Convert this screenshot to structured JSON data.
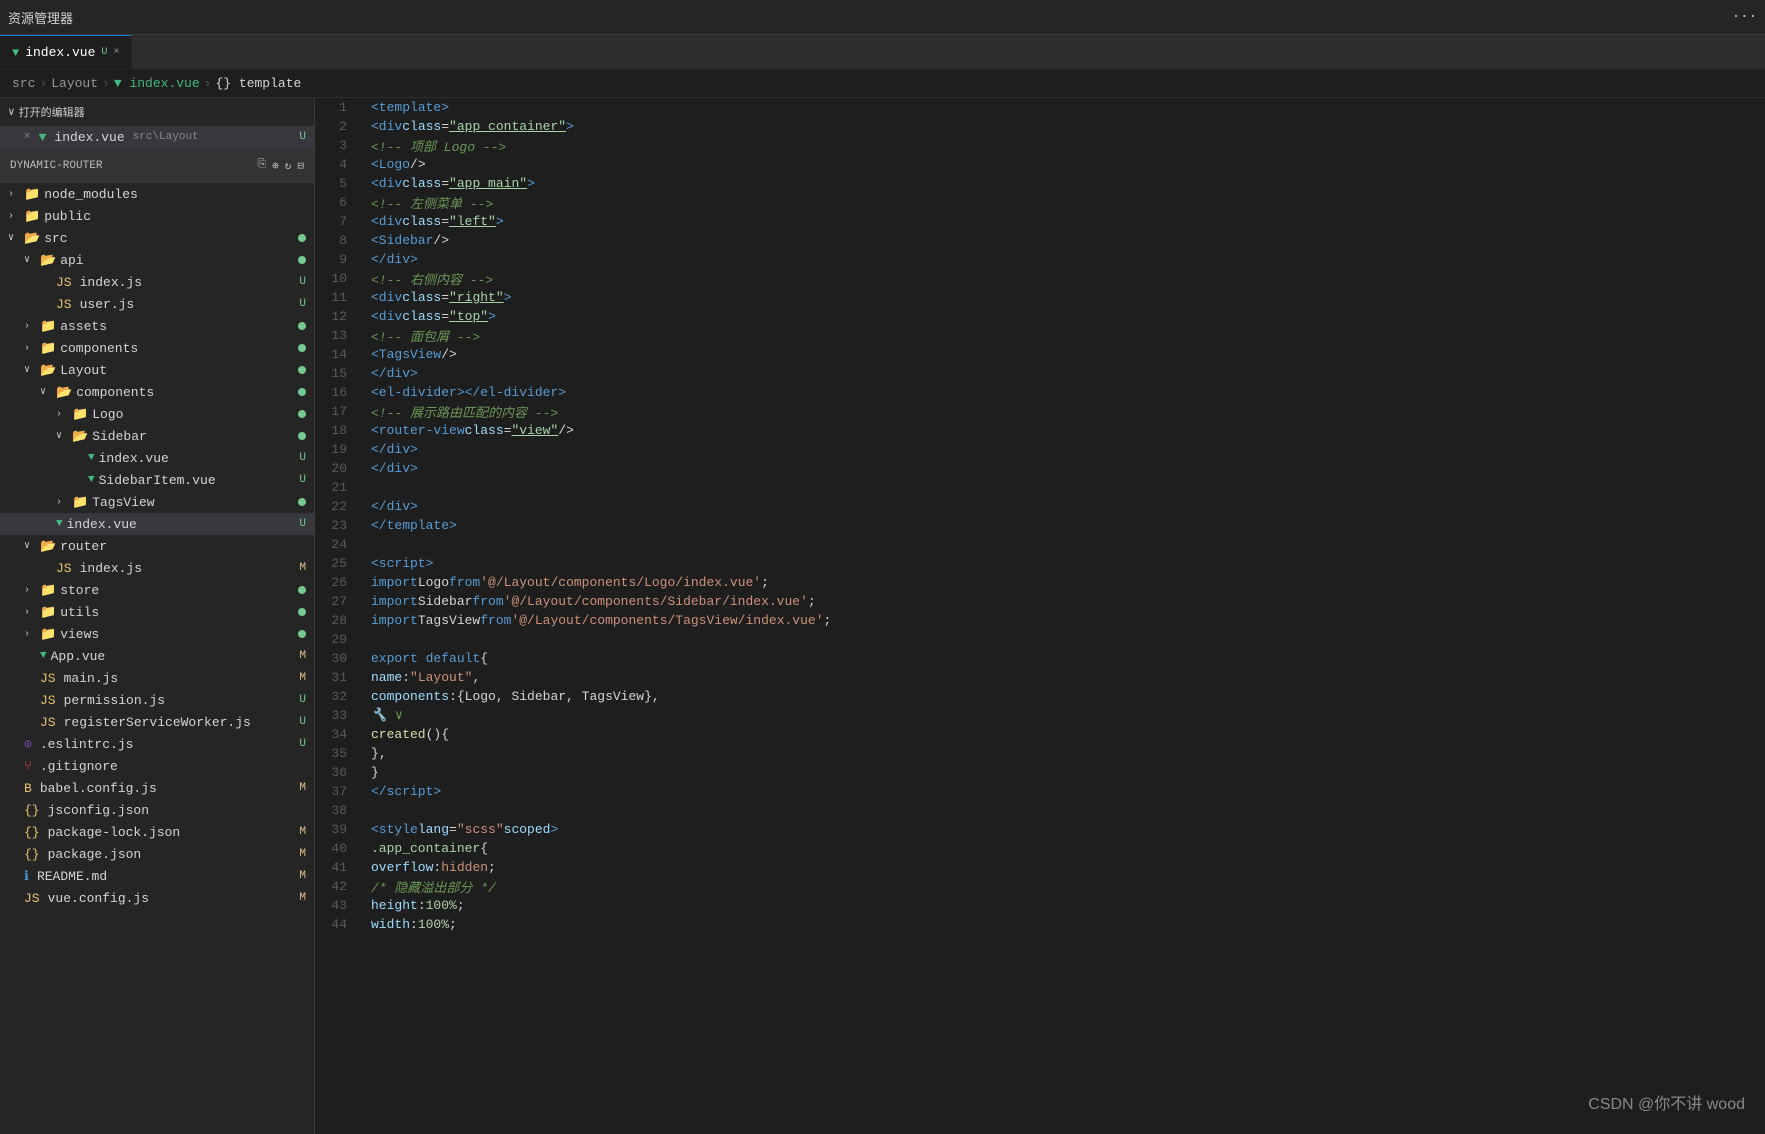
{
  "topbar": {
    "title": "资源管理器",
    "icons": [
      "...",
      "×"
    ]
  },
  "tabs": [
    {
      "id": "index-vue",
      "vue_icon": "▼",
      "label": "index.vue",
      "badge": "U",
      "close": "×",
      "active": true
    }
  ],
  "breadcrumb": {
    "parts": [
      "src",
      ">",
      "Layout",
      ">",
      "▼ index.vue",
      ">",
      "{} template"
    ]
  },
  "sidebar": {
    "open_editors_label": "打开的编辑器",
    "open_editors_arrow": "∨",
    "open_file": {
      "close_icon": "×",
      "vue_icon": "▼",
      "label": "index.vue",
      "path": "src\\Layout",
      "badge": "U"
    },
    "project_name": "DYNAMIC-ROUTER",
    "project_icons": [
      "copy",
      "add-folder",
      "refresh",
      "collapse"
    ],
    "tree": [
      {
        "level": 0,
        "arrow": "›",
        "type": "folder",
        "name": "node_modules",
        "badge": ""
      },
      {
        "level": 0,
        "arrow": "›",
        "type": "folder",
        "name": "public",
        "badge": ""
      },
      {
        "level": 0,
        "arrow": "∨",
        "type": "folder-open",
        "name": "src",
        "dot": "green"
      },
      {
        "level": 1,
        "arrow": "∨",
        "type": "folder-open",
        "name": "api",
        "dot": "green"
      },
      {
        "level": 2,
        "arrow": "",
        "type": "js",
        "name": "index.js",
        "badge": "U"
      },
      {
        "level": 2,
        "arrow": "",
        "type": "js",
        "name": "user.js",
        "badge": "U"
      },
      {
        "level": 1,
        "arrow": "›",
        "type": "folder",
        "name": "assets",
        "dot": "green"
      },
      {
        "level": 1,
        "arrow": "›",
        "type": "folder",
        "name": "components",
        "dot": "green"
      },
      {
        "level": 1,
        "arrow": "∨",
        "type": "folder-open",
        "name": "Layout",
        "dot": "green"
      },
      {
        "level": 2,
        "arrow": "∨",
        "type": "folder-open",
        "name": "components",
        "dot": "green"
      },
      {
        "level": 3,
        "arrow": "›",
        "type": "folder",
        "name": "Logo",
        "dot": "green"
      },
      {
        "level": 3,
        "arrow": "∨",
        "type": "folder-open",
        "name": "Sidebar",
        "dot": "green"
      },
      {
        "level": 4,
        "arrow": "",
        "type": "vue",
        "name": "index.vue",
        "badge": "U"
      },
      {
        "level": 4,
        "arrow": "",
        "type": "vue",
        "name": "SidebarItem.vue",
        "badge": "U"
      },
      {
        "level": 3,
        "arrow": "›",
        "type": "folder",
        "name": "TagsView",
        "dot": "green"
      },
      {
        "level": 2,
        "arrow": "",
        "type": "vue",
        "name": "index.vue",
        "badge": "U",
        "active": true
      },
      {
        "level": 1,
        "arrow": "∨",
        "type": "folder-open",
        "name": "router",
        "badge": ""
      },
      {
        "level": 2,
        "arrow": "",
        "type": "js",
        "name": "index.js",
        "badge": "M"
      },
      {
        "level": 1,
        "arrow": "›",
        "type": "folder",
        "name": "store",
        "dot": "green"
      },
      {
        "level": 1,
        "arrow": "›",
        "type": "folder",
        "name": "utils",
        "dot": "green"
      },
      {
        "level": 1,
        "arrow": "›",
        "type": "folder",
        "name": "views",
        "dot": "green"
      },
      {
        "level": 1,
        "arrow": "",
        "type": "vue",
        "name": "App.vue",
        "badge": "M"
      },
      {
        "level": 1,
        "arrow": "",
        "type": "js",
        "name": "main.js",
        "badge": "M"
      },
      {
        "level": 1,
        "arrow": "",
        "type": "js",
        "name": "permission.js",
        "badge": "U"
      },
      {
        "level": 1,
        "arrow": "",
        "type": "js",
        "name": "registerServiceWorker.js",
        "badge": "U"
      },
      {
        "level": 0,
        "arrow": "",
        "type": "eslint",
        "name": ".eslintrc.js",
        "badge": "U"
      },
      {
        "level": 0,
        "arrow": "",
        "type": "dot",
        "name": ".gitignore",
        "badge": ""
      },
      {
        "level": 0,
        "arrow": "",
        "type": "babel",
        "name": "babel.config.js",
        "badge": "M"
      },
      {
        "level": 0,
        "arrow": "",
        "type": "json",
        "name": "jsconfig.json",
        "badge": ""
      },
      {
        "level": 0,
        "arrow": "",
        "type": "json",
        "name": "package-lock.json",
        "badge": "M"
      },
      {
        "level": 0,
        "arrow": "",
        "type": "json",
        "name": "package.json",
        "badge": "M"
      },
      {
        "level": 0,
        "arrow": "",
        "type": "readme",
        "name": "README.md",
        "badge": "M"
      },
      {
        "level": 0,
        "arrow": "",
        "type": "js",
        "name": "vue.config.js",
        "badge": "M"
      }
    ]
  },
  "code": {
    "lines": [
      {
        "n": 1,
        "html": "<span class='t-tag'>&lt;template&gt;</span>"
      },
      {
        "n": 2,
        "html": "  <span class='t-tag'>&lt;div</span> <span class='t-attr-name'>class</span><span class='t-punct'>=</span><span class='t-attr-val t-class-u'>\"app_container\"</span><span class='t-tag'>&gt;</span>"
      },
      {
        "n": 3,
        "html": "    <span class='t-comment'>&lt;!-- 项部 Logo --&gt;</span>"
      },
      {
        "n": 4,
        "html": "    <span class='t-tag'>&lt;Logo</span> <span class='t-punct'>/&gt;</span>"
      },
      {
        "n": 5,
        "html": "    <span class='t-tag'>&lt;div</span> <span class='t-attr-name'>class</span><span class='t-punct'>=</span><span class='t-attr-val t-class-u'>\"app_main\"</span><span class='t-tag'>&gt;</span>"
      },
      {
        "n": 6,
        "html": "      <span class='t-comment'>&lt;!-- 左侧菜单 --&gt;</span>"
      },
      {
        "n": 7,
        "html": "      <span class='t-tag'>&lt;div</span> <span class='t-attr-name'>class</span><span class='t-punct'>=</span><span class='t-attr-val t-class-u'>\"left\"</span><span class='t-tag'>&gt;</span>"
      },
      {
        "n": 8,
        "html": "        <span class='t-tag'>&lt;Sidebar</span> <span class='t-punct'>/&gt;</span>"
      },
      {
        "n": 9,
        "html": "      <span class='t-tag'>&lt;/div&gt;</span>"
      },
      {
        "n": 10,
        "html": "      <span class='t-comment'>&lt;!-- 右侧内容 --&gt;</span>"
      },
      {
        "n": 11,
        "html": "      <span class='t-tag'>&lt;div</span> <span class='t-attr-name'>class</span><span class='t-punct'>=</span><span class='t-attr-val t-class-u'>\"right\"</span><span class='t-tag'>&gt;</span>"
      },
      {
        "n": 12,
        "html": "        <span class='t-tag'>&lt;div</span> <span class='t-attr-name'>class</span><span class='t-punct'>=</span><span class='t-attr-val t-class-u'>\"top\"</span><span class='t-tag'>&gt;</span>"
      },
      {
        "n": 13,
        "html": "          <span class='t-comment'>&lt;!-- 面包屑 --&gt;</span>"
      },
      {
        "n": 14,
        "html": "          <span class='t-tag'>&lt;TagsView</span> <span class='t-punct'>/&gt;</span>"
      },
      {
        "n": 15,
        "html": "        <span class='t-tag'>&lt;/div&gt;</span>"
      },
      {
        "n": 16,
        "html": "        <span class='t-tag'>&lt;el-divider&gt;&lt;/el-divider&gt;</span>"
      },
      {
        "n": 17,
        "html": "        <span class='t-comment'>&lt;!-- 展示路由匹配的内容 --&gt;</span>"
      },
      {
        "n": 18,
        "html": "        <span class='t-tag'>&lt;router-view</span> <span class='t-attr-name'>class</span><span class='t-punct'>=</span><span class='t-attr-val t-class-u'>\"view\"</span> <span class='t-punct'>/&gt;</span>"
      },
      {
        "n": 19,
        "html": "      <span class='t-tag'>&lt;/div&gt;</span>"
      },
      {
        "n": 20,
        "html": "    <span class='t-tag'>&lt;/div&gt;</span>"
      },
      {
        "n": 21,
        "html": ""
      },
      {
        "n": 22,
        "html": "  <span class='t-tag'>&lt;/div&gt;</span>"
      },
      {
        "n": 23,
        "html": "<span class='t-tag'>&lt;/template&gt;</span>"
      },
      {
        "n": 24,
        "html": ""
      },
      {
        "n": 25,
        "html": "<span class='t-tag'>&lt;script&gt;</span>"
      },
      {
        "n": 26,
        "html": "<span class='t-keyword'>import</span> <span class='t-white'>Logo</span> <span class='t-keyword'>from</span> <span class='t-import-path'>'@/Layout/components/Logo/index.vue'</span><span class='t-punct'>;</span>"
      },
      {
        "n": 27,
        "html": "<span class='t-keyword'>import</span> <span class='t-white'>Sidebar</span> <span class='t-keyword'>from</span> <span class='t-import-path'>'@/Layout/components/Sidebar/index.vue'</span><span class='t-punct'>;</span>"
      },
      {
        "n": 28,
        "html": "<span class='t-keyword'>import</span> <span class='t-white'>TagsView</span> <span class='t-keyword'>from</span> <span class='t-import-path'>'@/Layout/components/TagsView/index.vue'</span><span class='t-punct'>;</span>"
      },
      {
        "n": 29,
        "html": ""
      },
      {
        "n": 30,
        "html": "<span class='t-keyword'>export default</span> <span class='t-brace'>{</span>"
      },
      {
        "n": 31,
        "html": "  <span class='t-property'>name</span><span class='t-punct'>:</span> <span class='t-value-str'>\"Layout\"</span><span class='t-punct'>,</span>"
      },
      {
        "n": 32,
        "html": "  <span class='t-property'>components</span><span class='t-punct'>:</span> <span class='t-brace'>{</span> <span class='t-white'>Logo, Sidebar, TagsView</span> <span class='t-brace'>}</span><span class='t-punct'>,</span>"
      },
      {
        "n": 33,
        "html": "    <span class='t-comment'>🔧 ∨</span>"
      },
      {
        "n": 34,
        "html": "  <span class='t-func'>created</span><span class='t-punct'>()</span> <span class='t-brace'>{</span>"
      },
      {
        "n": 35,
        "html": "  <span class='t-brace'>}</span><span class='t-punct'>,</span>"
      },
      {
        "n": 36,
        "html": "<span class='t-brace'>}</span>"
      },
      {
        "n": 37,
        "html": "<span class='t-tag'>&lt;/script&gt;</span>"
      },
      {
        "n": 38,
        "html": ""
      },
      {
        "n": 39,
        "html": "<span class='t-tag'>&lt;style</span> <span class='t-attr-name'>lang</span><span class='t-punct'>=</span><span class='t-attr-val'>\"scss\"</span> <span class='t-attr-name'>scoped</span><span class='t-tag'>&gt;</span>"
      },
      {
        "n": 40,
        "html": "<span class='t-class'>.app_container</span> <span class='t-brace'>{</span>"
      },
      {
        "n": 41,
        "html": "  <span class='t-property'>overflow</span><span class='t-punct'>:</span> <span class='t-value-str'>hidden</span><span class='t-punct'>;</span>"
      },
      {
        "n": 42,
        "html": "  <span class='t-comment'>/* 隐藏溢出部分 */</span>"
      },
      {
        "n": 43,
        "html": "  <span class='t-property'>height</span><span class='t-punct'>:</span> <span class='t-number'>100%</span><span class='t-punct'>;</span>"
      },
      {
        "n": 44,
        "html": "  <span class='t-property'>width</span><span class='t-punct'>:</span> <span class='t-number'>100%</span><span class='t-punct'>;</span>"
      }
    ]
  },
  "watermark": "CSDN @你不讲 wood"
}
